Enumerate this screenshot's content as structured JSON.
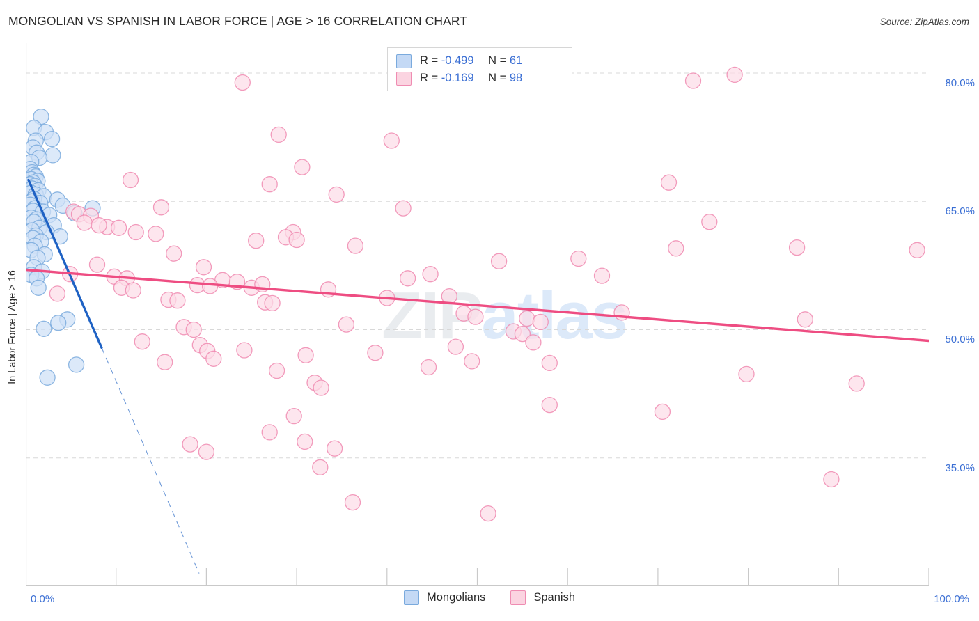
{
  "header": {
    "title": "MONGOLIAN VS SPANISH IN LABOR FORCE | AGE > 16 CORRELATION CHART",
    "source": "Source: ZipAtlas.com"
  },
  "stats_legend": {
    "rows": [
      {
        "series": "Mongolians",
        "color": "#c4d9f5",
        "r_label": "R =",
        "r_value": "-0.499",
        "n_label": "N =",
        "n_value": "61"
      },
      {
        "series": "Spanish",
        "color": "#fbd4e1",
        "r_label": "R =",
        "r_value": "-0.169",
        "n_label": "N =",
        "n_value": "98"
      }
    ]
  },
  "series_legend": [
    {
      "label": "Mongolians",
      "color": "#c4d9f5",
      "border": "#7aaadd"
    },
    {
      "label": "Spanish",
      "color": "#fbd4e1",
      "border": "#ef8cb2"
    }
  ],
  "watermark": {
    "part1": "ZIP",
    "part2": "atlas"
  },
  "chart_data": {
    "type": "scatter",
    "title": "MONGOLIAN VS SPANISH IN LABOR FORCE | AGE > 16 CORRELATION CHART",
    "xlabel": "",
    "ylabel": "In Labor Force | Age > 16",
    "xlim": [
      0,
      100
    ],
    "ylim": [
      20.0,
      83.5
    ],
    "grid": true,
    "legend_position": "bottom-center",
    "x_ticks": [
      0,
      10,
      20,
      30,
      40,
      50,
      60,
      70,
      80,
      90,
      100
    ],
    "x_tick_labels": [
      "0.0%",
      "",
      "",
      "",
      "",
      "",
      "",
      "",
      "",
      "",
      "100.0%"
    ],
    "y_ticks": [
      35.0,
      50.0,
      65.0,
      80.0
    ],
    "y_tick_labels": [
      "35.0%",
      "50.0%",
      "65.0%",
      "80.0%"
    ],
    "marker_radius_px": 11,
    "series": [
      {
        "name": "Mongolians",
        "color": "#cfe0f7",
        "edge": "#7aaadd",
        "r": -0.499,
        "n": 61,
        "trendline": {
          "style": "solid",
          "color": "#1f62c4",
          "x0": 0.3,
          "y0": 67.5,
          "x1": 8.4,
          "y1": 47.9
        },
        "trendline_extension": {
          "style": "dashed",
          "color": "#6f9ad8",
          "x0": 8.4,
          "y0": 47.9,
          "x1": 19.2,
          "y1": 21.5
        },
        "points": [
          [
            1.7,
            74.9
          ],
          [
            0.9,
            73.6
          ],
          [
            2.2,
            73.1
          ],
          [
            1.1,
            72.1
          ],
          [
            2.9,
            72.3
          ],
          [
            0.8,
            71.3
          ],
          [
            1.2,
            70.7
          ],
          [
            3.0,
            70.4
          ],
          [
            1.5,
            70.1
          ],
          [
            0.6,
            69.6
          ],
          [
            0.5,
            68.8
          ],
          [
            0.7,
            68.4
          ],
          [
            0.9,
            68.1
          ],
          [
            1.1,
            67.9
          ],
          [
            0.6,
            67.6
          ],
          [
            1.3,
            67.4
          ],
          [
            0.8,
            67.2
          ],
          [
            0.5,
            67.0
          ],
          [
            1.0,
            66.8
          ],
          [
            0.7,
            66.5
          ],
          [
            1.4,
            66.3
          ],
          [
            0.6,
            66.0
          ],
          [
            1.1,
            65.8
          ],
          [
            2.0,
            65.6
          ],
          [
            0.9,
            65.3
          ],
          [
            3.5,
            65.2
          ],
          [
            0.7,
            65.0
          ],
          [
            1.6,
            64.8
          ],
          [
            0.5,
            64.6
          ],
          [
            4.1,
            64.5
          ],
          [
            1.0,
            64.2
          ],
          [
            0.8,
            63.9
          ],
          [
            1.9,
            63.8
          ],
          [
            7.4,
            64.2
          ],
          [
            2.6,
            63.4
          ],
          [
            0.6,
            63.1
          ],
          [
            1.2,
            62.9
          ],
          [
            0.9,
            62.6
          ],
          [
            5.4,
            63.6
          ],
          [
            3.1,
            62.2
          ],
          [
            1.5,
            61.9
          ],
          [
            0.7,
            61.6
          ],
          [
            2.3,
            61.4
          ],
          [
            1.1,
            61.0
          ],
          [
            0.8,
            60.7
          ],
          [
            3.8,
            60.9
          ],
          [
            1.7,
            60.3
          ],
          [
            1.0,
            59.8
          ],
          [
            0.6,
            59.3
          ],
          [
            2.1,
            58.8
          ],
          [
            1.3,
            58.4
          ],
          [
            0.9,
            57.3
          ],
          [
            1.8,
            56.8
          ],
          [
            0.6,
            56.4
          ],
          [
            1.2,
            56.0
          ],
          [
            4.6,
            51.2
          ],
          [
            3.6,
            50.8
          ],
          [
            2.0,
            50.1
          ],
          [
            5.6,
            45.9
          ],
          [
            2.4,
            44.4
          ],
          [
            1.4,
            54.9
          ]
        ]
      },
      {
        "name": "Spanish",
        "color": "#fcdde8",
        "edge": "#f08ab0",
        "r": -0.169,
        "n": 98,
        "trendline": {
          "style": "solid",
          "color": "#ee4d82",
          "x0": 0.0,
          "y0": 57.0,
          "x1": 100.0,
          "y1": 48.7
        },
        "points": [
          [
            24.0,
            78.9
          ],
          [
            78.5,
            79.8
          ],
          [
            73.9,
            79.1
          ],
          [
            28.0,
            72.8
          ],
          [
            40.5,
            72.1
          ],
          [
            30.6,
            69.0
          ],
          [
            11.6,
            67.5
          ],
          [
            27.0,
            67.0
          ],
          [
            34.4,
            65.8
          ],
          [
            71.2,
            67.2
          ],
          [
            41.8,
            64.2
          ],
          [
            15.0,
            64.3
          ],
          [
            5.3,
            63.8
          ],
          [
            5.9,
            63.5
          ],
          [
            7.2,
            63.3
          ],
          [
            75.7,
            62.6
          ],
          [
            9.0,
            62.0
          ],
          [
            6.5,
            62.5
          ],
          [
            8.1,
            62.2
          ],
          [
            10.3,
            61.9
          ],
          [
            12.2,
            61.4
          ],
          [
            29.6,
            61.4
          ],
          [
            14.4,
            61.2
          ],
          [
            28.8,
            60.8
          ],
          [
            30.0,
            60.5
          ],
          [
            25.5,
            60.4
          ],
          [
            36.5,
            59.8
          ],
          [
            72.0,
            59.5
          ],
          [
            85.4,
            59.6
          ],
          [
            98.7,
            59.3
          ],
          [
            16.4,
            58.9
          ],
          [
            7.9,
            57.6
          ],
          [
            19.7,
            57.3
          ],
          [
            52.4,
            58.0
          ],
          [
            61.2,
            58.3
          ],
          [
            4.9,
            56.5
          ],
          [
            9.8,
            56.2
          ],
          [
            11.2,
            56.0
          ],
          [
            21.8,
            55.8
          ],
          [
            23.4,
            55.6
          ],
          [
            42.3,
            56.0
          ],
          [
            44.8,
            56.5
          ],
          [
            63.8,
            56.3
          ],
          [
            19.0,
            55.2
          ],
          [
            20.4,
            55.1
          ],
          [
            25.0,
            54.9
          ],
          [
            26.2,
            55.3
          ],
          [
            10.6,
            54.9
          ],
          [
            11.9,
            54.6
          ],
          [
            3.5,
            54.2
          ],
          [
            15.8,
            53.5
          ],
          [
            16.8,
            53.4
          ],
          [
            33.5,
            54.7
          ],
          [
            40.0,
            53.7
          ],
          [
            46.9,
            53.9
          ],
          [
            26.5,
            53.2
          ],
          [
            27.3,
            53.1
          ],
          [
            48.5,
            51.9
          ],
          [
            49.8,
            51.5
          ],
          [
            55.5,
            51.3
          ],
          [
            57.0,
            50.9
          ],
          [
            86.3,
            51.2
          ],
          [
            17.5,
            50.3
          ],
          [
            18.6,
            50.0
          ],
          [
            35.5,
            50.6
          ],
          [
            54.0,
            49.8
          ],
          [
            55.0,
            49.5
          ],
          [
            12.9,
            48.6
          ],
          [
            19.3,
            48.2
          ],
          [
            20.1,
            47.5
          ],
          [
            24.2,
            47.6
          ],
          [
            47.6,
            48.0
          ],
          [
            56.2,
            48.5
          ],
          [
            31.0,
            47.0
          ],
          [
            38.7,
            47.3
          ],
          [
            15.4,
            46.2
          ],
          [
            20.8,
            46.6
          ],
          [
            27.8,
            45.2
          ],
          [
            44.6,
            45.6
          ],
          [
            49.4,
            46.3
          ],
          [
            58.0,
            46.1
          ],
          [
            79.8,
            44.8
          ],
          [
            92.0,
            43.7
          ],
          [
            32.0,
            43.8
          ],
          [
            32.7,
            43.2
          ],
          [
            58.0,
            41.2
          ],
          [
            29.7,
            39.9
          ],
          [
            70.5,
            40.4
          ],
          [
            27.0,
            38.0
          ],
          [
            18.2,
            36.6
          ],
          [
            30.9,
            36.9
          ],
          [
            20.0,
            35.7
          ],
          [
            34.2,
            36.1
          ],
          [
            32.6,
            33.9
          ],
          [
            89.2,
            32.5
          ],
          [
            36.2,
            29.8
          ],
          [
            51.2,
            28.5
          ],
          [
            66.0,
            52.0
          ]
        ]
      }
    ]
  }
}
